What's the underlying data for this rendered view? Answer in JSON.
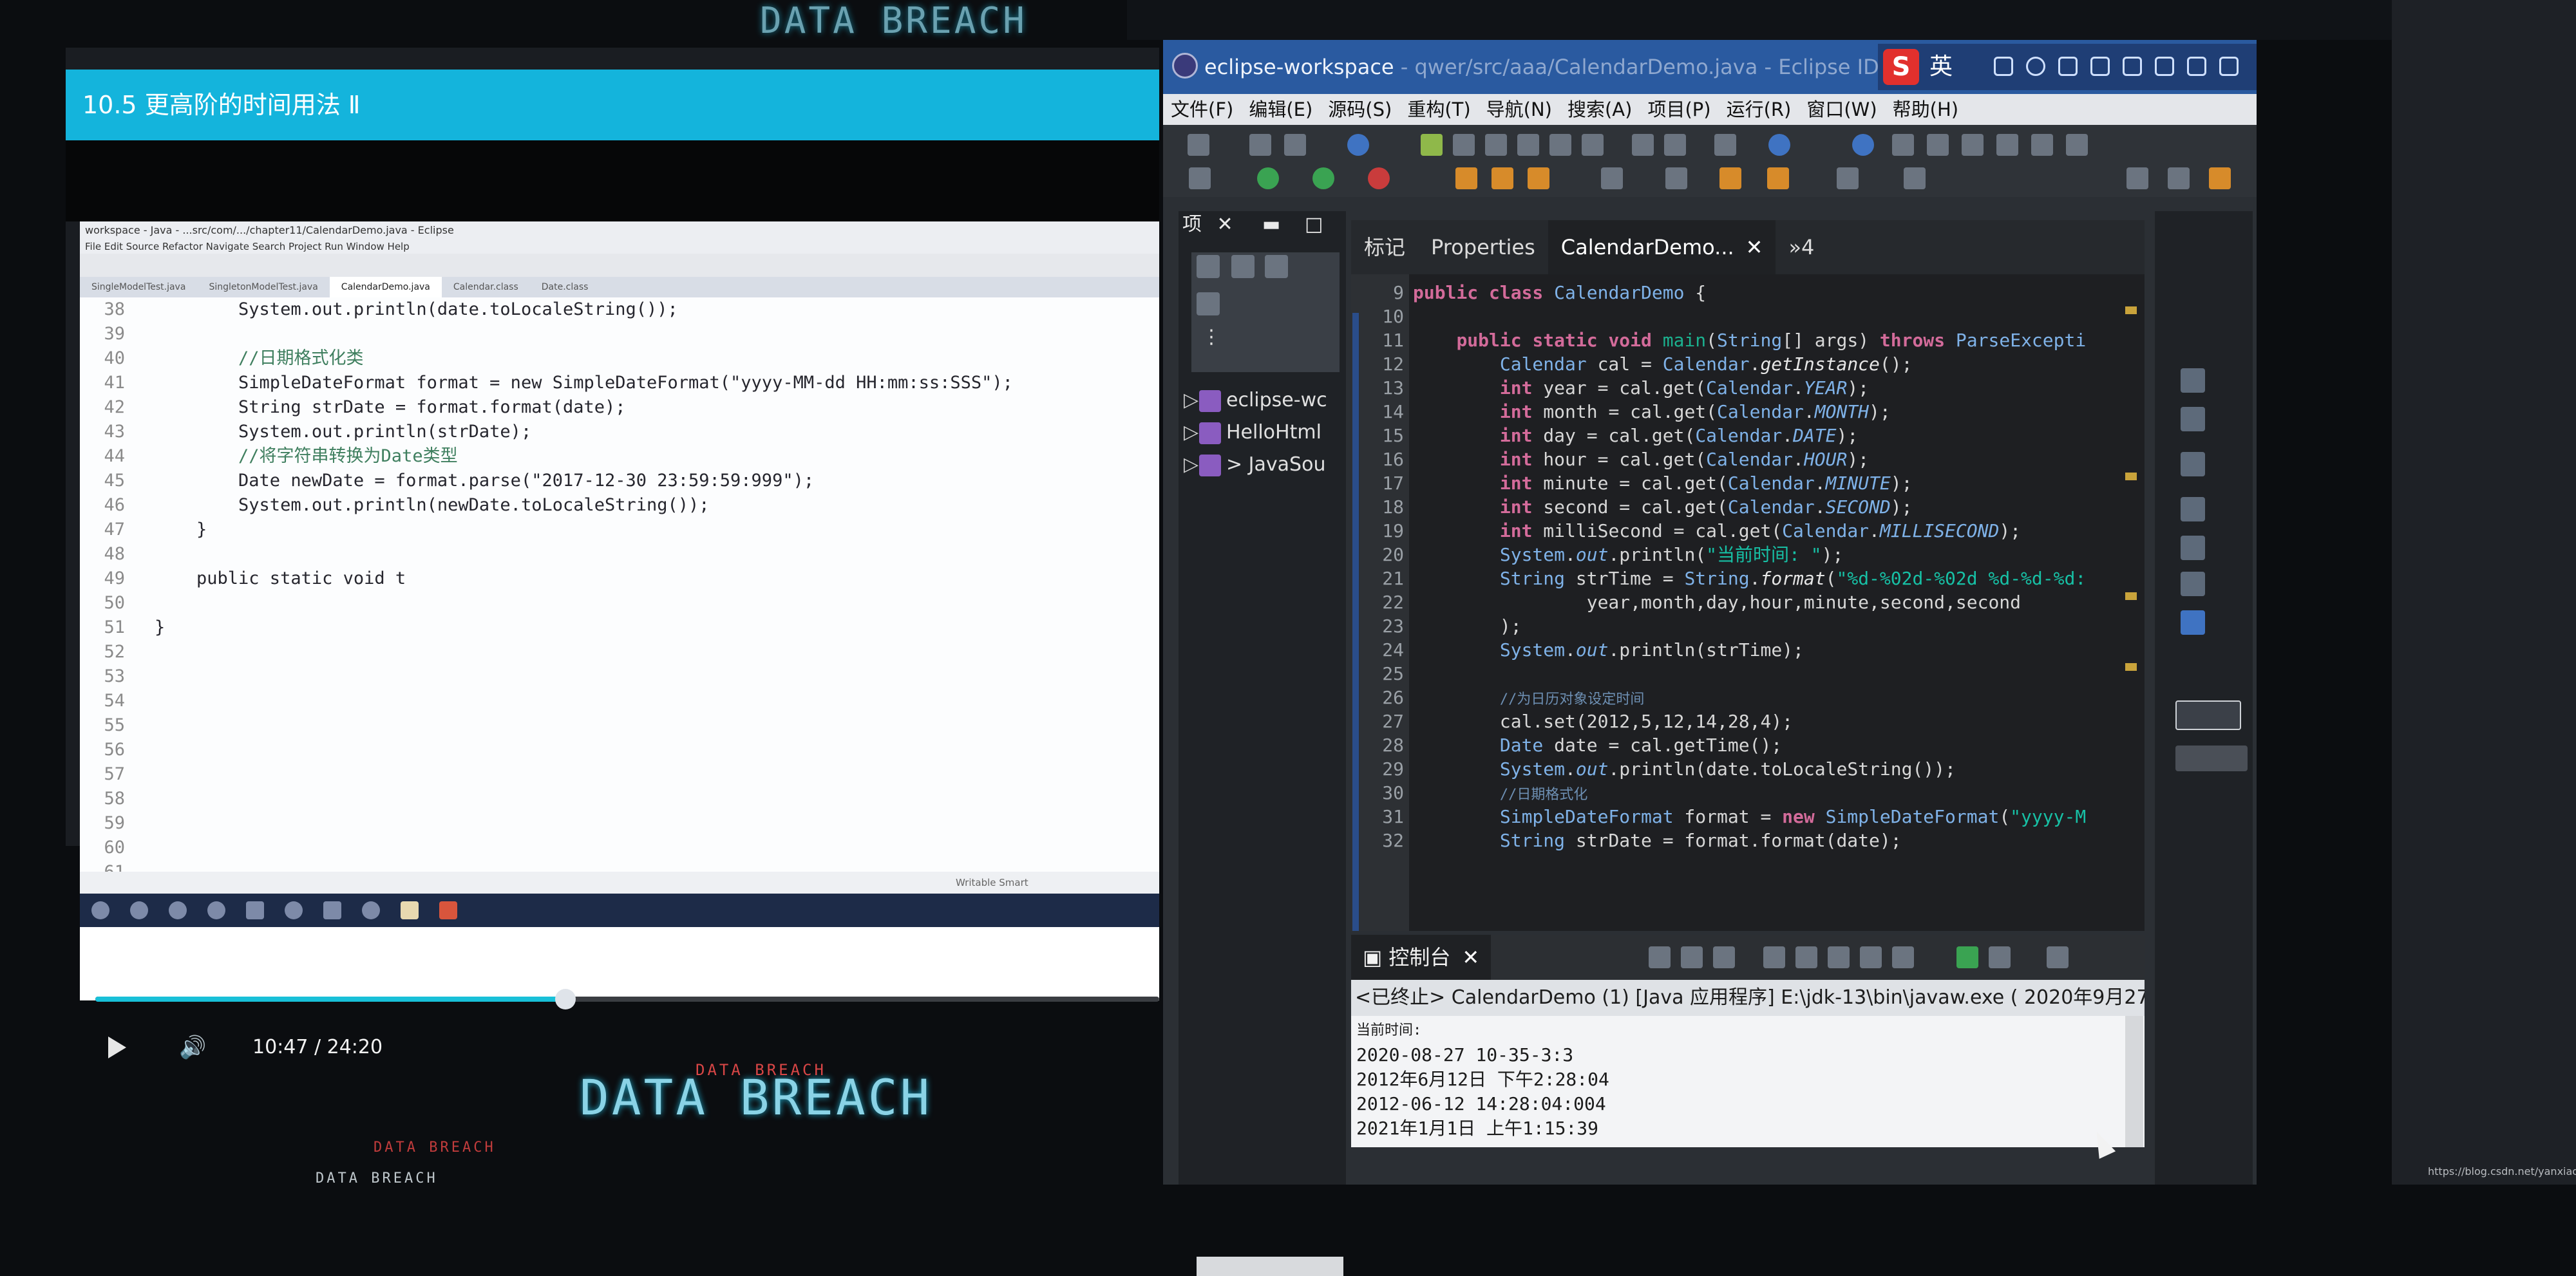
{
  "video": {
    "title": "10.5 更高阶的时间用法 Ⅱ",
    "time": "10:47 / 24:20",
    "progress": 0.442,
    "inner_window_title": "workspace - Java - ...src/com/.../chapter11/CalendarDemo.java - Eclipse",
    "inner_menu": "File  Edit  Source  Refactor  Navigate  Search  Project  Run  Window  Help",
    "inner_tabs": [
      "SingleModelTest.java",
      "SingletonModelTest.java",
      "CalendarDemo.java",
      "Calendar.class",
      "Date.class"
    ],
    "inner_code": [
      {
        "n": "38",
        "text": "        System.out.println(date.toLocaleString());"
      },
      {
        "n": "39",
        "text": ""
      },
      {
        "n": "40",
        "text": "        //日期格式化类",
        "type": "comment"
      },
      {
        "n": "41",
        "text": "        SimpleDateFormat format = new SimpleDateFormat(\"yyyy-MM-dd HH:mm:ss:SSS\");"
      },
      {
        "n": "42",
        "text": "        String strDate = format.format(date);"
      },
      {
        "n": "43",
        "text": "        System.out.println(strDate);"
      },
      {
        "n": "44",
        "text": "        //将字符串转换为Date类型",
        "type": "comment"
      },
      {
        "n": "45",
        "text": "        Date newDate = format.parse(\"2017-12-30 23:59:59:999\");"
      },
      {
        "n": "46",
        "text": "        System.out.println(newDate.toLocaleString());"
      },
      {
        "n": "47",
        "text": "    }"
      },
      {
        "n": "48",
        "text": ""
      },
      {
        "n": "49",
        "text": "    public static void t"
      },
      {
        "n": "50",
        "text": ""
      },
      {
        "n": "51",
        "text": "}"
      },
      {
        "n": "52",
        "text": ""
      },
      {
        "n": "53",
        "text": ""
      },
      {
        "n": "54",
        "text": ""
      },
      {
        "n": "55",
        "text": ""
      },
      {
        "n": "56",
        "text": ""
      },
      {
        "n": "57",
        "text": ""
      },
      {
        "n": "58",
        "text": ""
      },
      {
        "n": "59",
        "text": ""
      },
      {
        "n": "60",
        "text": ""
      },
      {
        "n": "61",
        "text": ""
      }
    ],
    "inner_status": "Writable        Smart"
  },
  "background": {
    "breach_big": "DATA BREACH",
    "breach_top": "DATA BREACH",
    "breach_small_1": "DATA BREACH",
    "breach_small_2": "DATA BREACH",
    "breach_small_3": "DATA BREACH"
  },
  "eclipse": {
    "title": "eclipse-workspace",
    "title_path": " - qwer/src/aaa/CalendarDemo.java - Eclipse IDE",
    "ime_mode": "英",
    "menu": [
      "文件(F)",
      "编辑(E)",
      "源码(S)",
      "重构(T)",
      "导航(N)",
      "搜索(A)",
      "项目(P)",
      "运行(R)",
      "窗口(W)",
      "帮助(H)"
    ],
    "explorer": {
      "header": "项",
      "items": [
        {
          "label": "eclipse-wc"
        },
        {
          "label": "HelloHtml"
        },
        {
          "label": "> JavaSou"
        }
      ]
    },
    "editor_tabs": [
      {
        "label": "标记"
      },
      {
        "label": "Properties"
      },
      {
        "label": "CalendarDemo...",
        "active": true
      },
      {
        "label": "»4"
      }
    ],
    "code": [
      {
        "n": "9",
        "parts": [
          [
            "kw",
            "public class "
          ],
          [
            "ty",
            "CalendarDemo"
          ],
          [
            "",
            ""
          ],
          [
            "",
            " {"
          ]
        ]
      },
      {
        "n": "10",
        "parts": []
      },
      {
        "n": "11",
        "parts": [
          [
            "",
            "    "
          ],
          [
            "kw",
            "public static void "
          ],
          [
            "fn",
            "main"
          ],
          [
            "",
            "("
          ],
          [
            "ty",
            "String"
          ],
          [
            "",
            "[] args) "
          ],
          [
            "kw",
            "throws "
          ],
          [
            "ty",
            "ParseExcepti"
          ]
        ]
      },
      {
        "n": "12",
        "parts": [
          [
            "",
            "        "
          ],
          [
            "ty",
            "Calendar"
          ],
          [
            "",
            " cal = "
          ],
          [
            "ty",
            "Calendar"
          ],
          [
            "",
            "."
          ],
          [
            "sm",
            "getInstance"
          ],
          [
            "",
            "();"
          ]
        ]
      },
      {
        "n": "13",
        "parts": [
          [
            "",
            "        "
          ],
          [
            "kw",
            "int"
          ],
          [
            "",
            " year = cal.get("
          ],
          [
            "ty",
            "Calendar"
          ],
          [
            "",
            "."
          ],
          [
            "fld",
            "YEAR"
          ],
          [
            "",
            ");"
          ]
        ]
      },
      {
        "n": "14",
        "parts": [
          [
            "",
            "        "
          ],
          [
            "kw",
            "int"
          ],
          [
            "",
            " month = cal.get("
          ],
          [
            "ty",
            "Calendar"
          ],
          [
            "",
            "."
          ],
          [
            "fld",
            "MONTH"
          ],
          [
            "",
            ");"
          ]
        ]
      },
      {
        "n": "15",
        "parts": [
          [
            "",
            "        "
          ],
          [
            "kw",
            "int"
          ],
          [
            "",
            " day = cal.get("
          ],
          [
            "ty",
            "Calendar"
          ],
          [
            "",
            "."
          ],
          [
            "fld",
            "DATE"
          ],
          [
            "",
            ");"
          ]
        ]
      },
      {
        "n": "16",
        "parts": [
          [
            "",
            "        "
          ],
          [
            "kw",
            "int"
          ],
          [
            "",
            " hour = cal.get("
          ],
          [
            "ty",
            "Calendar"
          ],
          [
            "",
            "."
          ],
          [
            "fld",
            "HOUR"
          ],
          [
            "",
            ");"
          ]
        ]
      },
      {
        "n": "17",
        "parts": [
          [
            "",
            "        "
          ],
          [
            "kw",
            "int"
          ],
          [
            "",
            " minute = cal.get("
          ],
          [
            "ty",
            "Calendar"
          ],
          [
            "",
            "."
          ],
          [
            "fld",
            "MINUTE"
          ],
          [
            "",
            ");"
          ]
        ]
      },
      {
        "n": "18",
        "parts": [
          [
            "",
            "        "
          ],
          [
            "kw",
            "int"
          ],
          [
            "",
            " second = cal.get("
          ],
          [
            "ty",
            "Calendar"
          ],
          [
            "",
            "."
          ],
          [
            "fld",
            "SECOND"
          ],
          [
            "",
            ");"
          ]
        ]
      },
      {
        "n": "19",
        "parts": [
          [
            "",
            "        "
          ],
          [
            "kw",
            "int"
          ],
          [
            "",
            " milliSecond = cal.get("
          ],
          [
            "ty",
            "Calendar"
          ],
          [
            "",
            "."
          ],
          [
            "fld",
            "MILLISECOND"
          ],
          [
            "",
            ");"
          ]
        ]
      },
      {
        "n": "20",
        "parts": [
          [
            "",
            "        "
          ],
          [
            "ty",
            "System"
          ],
          [
            "",
            "."
          ],
          [
            "fld",
            "out"
          ],
          [
            "",
            ".println("
          ],
          [
            "str",
            "\"当前时间: \""
          ],
          [
            "",
            ");"
          ]
        ]
      },
      {
        "n": "21",
        "parts": [
          [
            "",
            "        "
          ],
          [
            "ty",
            "String"
          ],
          [
            "",
            " strTime = "
          ],
          [
            "ty",
            "String"
          ],
          [
            "",
            "."
          ],
          [
            "sm",
            "format"
          ],
          [
            "",
            "("
          ],
          [
            "str",
            "\"%d-%02d-%02d %d-%d-%d:"
          ]
        ]
      },
      {
        "n": "22",
        "parts": [
          [
            "",
            "                year,month,day,hour,minute,second,second"
          ]
        ]
      },
      {
        "n": "23",
        "parts": [
          [
            "",
            "        );"
          ]
        ]
      },
      {
        "n": "24",
        "parts": [
          [
            "",
            "        "
          ],
          [
            "ty",
            "System"
          ],
          [
            "",
            "."
          ],
          [
            "fld",
            "out"
          ],
          [
            "",
            ".println(strTime);"
          ]
        ]
      },
      {
        "n": "25",
        "parts": []
      },
      {
        "n": "26",
        "parts": [
          [
            "",
            "        "
          ],
          [
            "cm",
            "//为日历对象设定时间"
          ]
        ]
      },
      {
        "n": "27",
        "parts": [
          [
            "",
            "        cal.set(2012,5,12,14,28,4);"
          ]
        ]
      },
      {
        "n": "28",
        "parts": [
          [
            "",
            "        "
          ],
          [
            "ty",
            "Date"
          ],
          [
            "",
            " date = cal.getTime();"
          ]
        ]
      },
      {
        "n": "29",
        "parts": [
          [
            "",
            "        "
          ],
          [
            "ty",
            "System"
          ],
          [
            "",
            "."
          ],
          [
            "fld",
            "out"
          ],
          [
            "",
            ".println(date.toLocaleString());"
          ]
        ]
      },
      {
        "n": "30",
        "parts": [
          [
            "",
            "        "
          ],
          [
            "cm",
            "//日期格式化"
          ]
        ]
      },
      {
        "n": "31",
        "parts": [
          [
            "",
            "        "
          ],
          [
            "ty",
            "SimpleDateFormat"
          ],
          [
            "",
            " format = "
          ],
          [
            "kw",
            "new "
          ],
          [
            "ty",
            "SimpleDateFormat"
          ],
          [
            "",
            "("
          ],
          [
            "str",
            "\"yyyy-M"
          ]
        ]
      },
      {
        "n": "32",
        "parts": [
          [
            "",
            "        "
          ],
          [
            "ty",
            "String"
          ],
          [
            "",
            " strDate = format.format(date);"
          ]
        ]
      }
    ],
    "console": {
      "tab": "控制台",
      "header": "<已终止> CalendarDemo (1) [Java 应用程序] E:\\jdk-13\\bin\\javaw.exe ( 2020年9月27",
      "lines": [
        {
          "text": "当前时间:",
          "small": true
        },
        {
          "text": "2020-08-27 10-35-3:3"
        },
        {
          "text": "2012年6月12日 下午2:28:04"
        },
        {
          "text": "2012-06-12 14:28:04:004"
        },
        {
          "text": "2021年1月1日 上午1:15:39"
        }
      ]
    },
    "watermark": "https://blog.csdn.net/yanxiaobiy"
  }
}
